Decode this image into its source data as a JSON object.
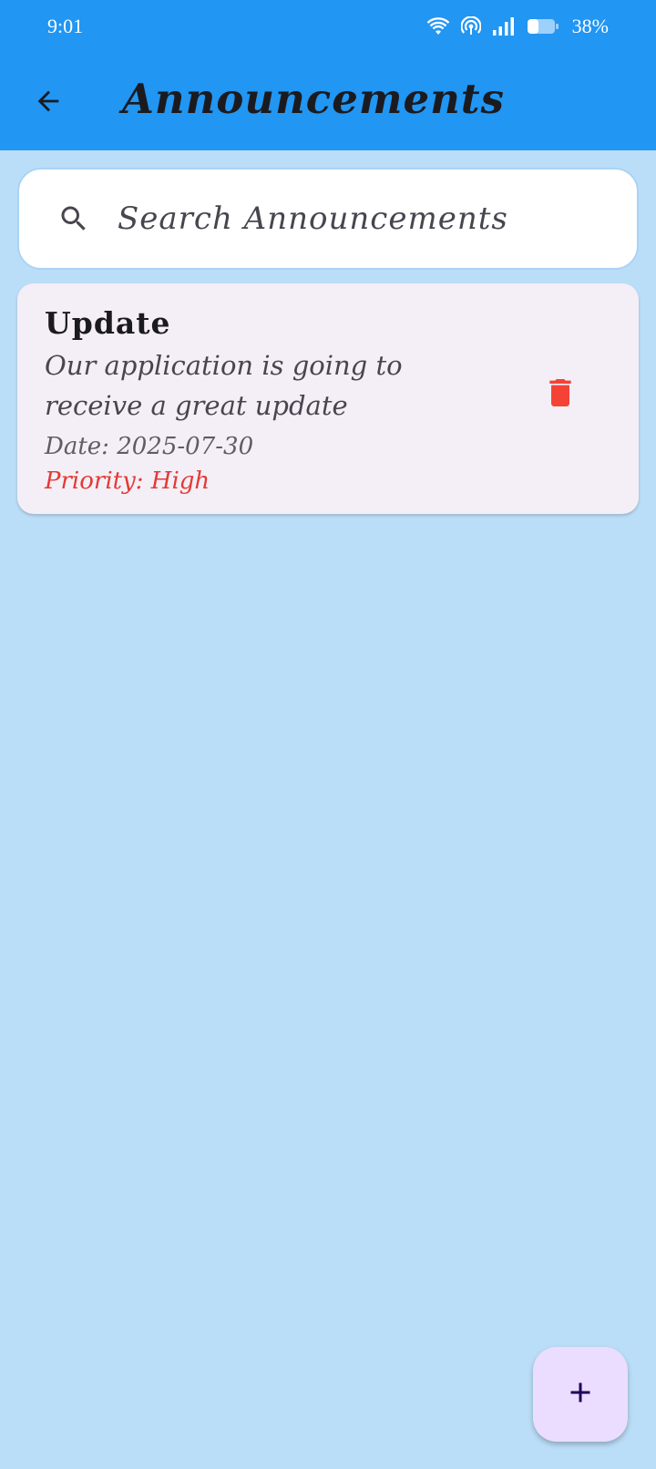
{
  "status_bar": {
    "time": "9:01",
    "battery": "38%",
    "icons": [
      "wifi-icon",
      "hotspot-icon",
      "signal-icon",
      "battery-icon"
    ]
  },
  "app_bar": {
    "title": "Announcements",
    "back_icon": "arrow-back-icon",
    "color": "#2196F3"
  },
  "search": {
    "placeholder": "Search Announcements",
    "value": "",
    "icon": "search-icon"
  },
  "announcements": [
    {
      "title": "Update",
      "description": "Our application is going to receive a great update",
      "date": "Date: 2025-07-30",
      "priority": "Priority: High",
      "priority_color": "#E53935",
      "delete_icon": "trash-icon"
    }
  ],
  "fab": {
    "icon": "add-icon",
    "color": "#EBDDFF"
  },
  "background_color": "#BBDEF8"
}
